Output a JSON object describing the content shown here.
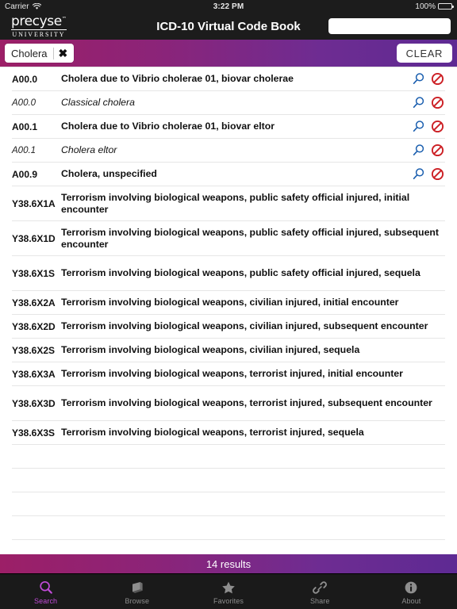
{
  "status_bar": {
    "carrier": "Carrier",
    "wifi_icon": "wifi-icon",
    "time": "3:22 PM",
    "battery_percent": "100%",
    "battery_icon": "battery-full-icon"
  },
  "nav_bar": {
    "logo_main": "precyse",
    "logo_tm": "™",
    "logo_sub": "UNIVERSITY",
    "title": "ICD-10 Virtual Code Book",
    "field_value": "",
    "field_placeholder": ""
  },
  "search_bar": {
    "token_text": "Cholera",
    "token_remove_icon": "close-x-icon",
    "clear_label": "CLEAR",
    "gradient_start": "#9C1F67",
    "gradient_end": "#5E2A93"
  },
  "results": {
    "rows": [
      {
        "code": "A00.0",
        "desc": "Cholera due to Vibrio cholerae 01, biovar cholerae",
        "style": "bold",
        "icons": true
      },
      {
        "code": "A00.0",
        "desc": "Classical cholera",
        "style": "italic",
        "icons": true
      },
      {
        "code": "A00.1",
        "desc": "Cholera due to Vibrio cholerae 01, biovar eltor",
        "style": "bold",
        "icons": true
      },
      {
        "code": "A00.1",
        "desc": "Cholera eltor",
        "style": "italic",
        "icons": true
      },
      {
        "code": "A00.9",
        "desc": "Cholera, unspecified",
        "style": "bold",
        "icons": true
      },
      {
        "code": "Y38.6X1A",
        "desc": "Terrorism involving biological weapons, public safety official injured, initial encounter",
        "style": "bold",
        "icons": false
      },
      {
        "code": "Y38.6X1D",
        "desc": "Terrorism involving biological weapons, public safety official injured, subsequent encounter",
        "style": "bold",
        "icons": false
      },
      {
        "code": "Y38.6X1S",
        "desc": "Terrorism involving biological weapons, public safety official injured, sequela",
        "style": "bold",
        "icons": false
      },
      {
        "code": "Y38.6X2A",
        "desc": "Terrorism involving biological weapons, civilian injured, initial encounter",
        "style": "bold",
        "icons": false
      },
      {
        "code": "Y38.6X2D",
        "desc": "Terrorism involving biological weapons, civilian injured, subsequent encounter",
        "style": "bold",
        "icons": false
      },
      {
        "code": "Y38.6X2S",
        "desc": "Terrorism involving biological weapons, civilian injured, sequela",
        "style": "bold",
        "icons": false
      },
      {
        "code": "Y38.6X3A",
        "desc": "Terrorism involving biological weapons, terrorist injured, initial encounter",
        "style": "bold",
        "icons": false
      },
      {
        "code": "Y38.6X3D",
        "desc": "Terrorism involving biological weapons, terrorist injured, subsequent encounter",
        "style": "bold",
        "icons": false
      },
      {
        "code": "Y38.6X3S",
        "desc": "Terrorism involving biological weapons, terrorist injured, sequela",
        "style": "bold",
        "icons": false
      },
      {
        "code": "",
        "desc": "",
        "style": "bold",
        "icons": false
      },
      {
        "code": "",
        "desc": "",
        "style": "bold",
        "icons": false
      },
      {
        "code": "",
        "desc": "",
        "style": "bold",
        "icons": false
      },
      {
        "code": "",
        "desc": "",
        "style": "bold",
        "icons": false
      },
      {
        "code": "",
        "desc": "",
        "style": "bold",
        "icons": false
      }
    ],
    "row_search_icon": "magnifier-icon",
    "row_exclude_icon": "prohibited-icon",
    "search_icon_color": "#1B5FAF",
    "exclude_icon_color": "#CC1F24"
  },
  "footer": {
    "results_label": "14 results"
  },
  "tabs": [
    {
      "label": "Search",
      "icon": "magnifier-icon",
      "active": true
    },
    {
      "label": "Browse",
      "icon": "book-icon",
      "active": false
    },
    {
      "label": "Favorites",
      "icon": "star-icon",
      "active": false
    },
    {
      "label": "Share",
      "icon": "link-icon",
      "active": false
    },
    {
      "label": "About",
      "icon": "info-icon",
      "active": false
    }
  ]
}
